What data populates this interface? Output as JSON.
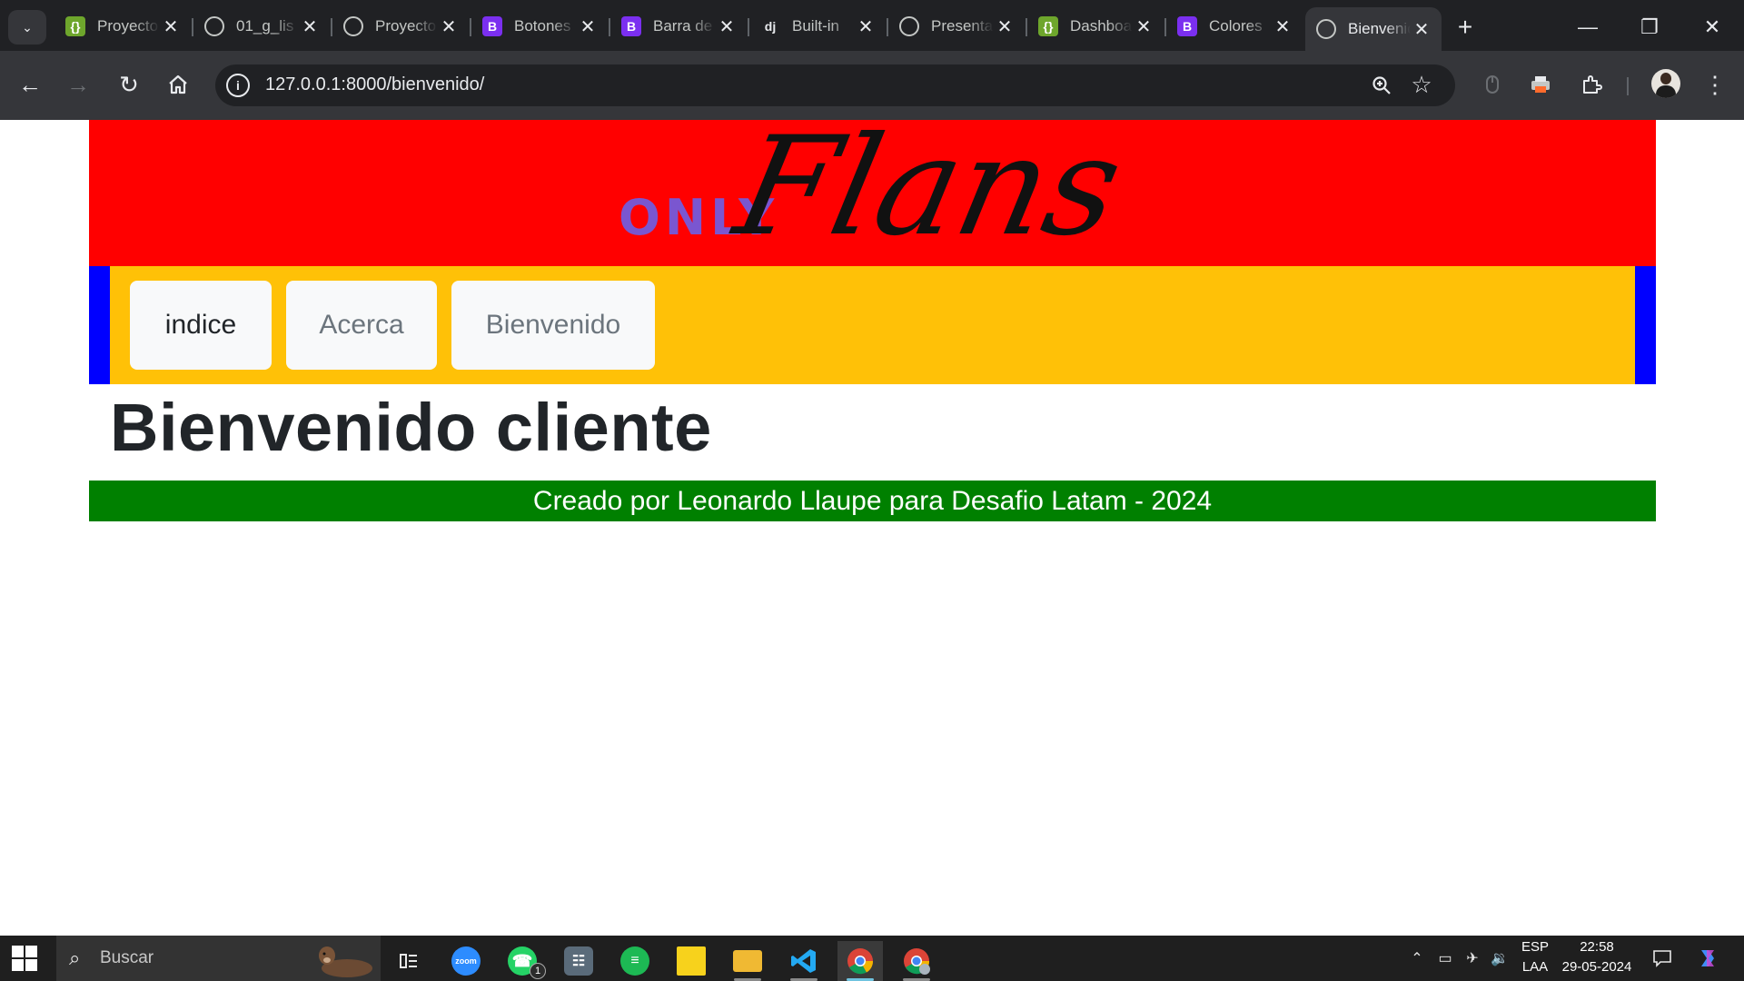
{
  "browser": {
    "tabs": [
      {
        "title": "Proyecto",
        "favicon": "json-icon"
      },
      {
        "title": "01_g_lis",
        "favicon": "globe-icon"
      },
      {
        "title": "Proyecto",
        "favicon": "globe-icon"
      },
      {
        "title": "Botones",
        "favicon": "bootstrap-icon"
      },
      {
        "title": "Barra de",
        "favicon": "bootstrap-icon"
      },
      {
        "title": "Built-in",
        "favicon": "django-icon"
      },
      {
        "title": "Presenta",
        "favicon": "globe-icon"
      },
      {
        "title": "Dashboar",
        "favicon": "json-icon"
      },
      {
        "title": "Colores",
        "favicon": "bootstrap-icon"
      },
      {
        "title": "Bienvenido",
        "favicon": "globe-icon",
        "active": true
      }
    ],
    "favicon_glyphs": {
      "json": "{}",
      "bootstrap": "B",
      "django": "dj"
    },
    "address_url": "127.0.0.1:8000/bienvenido/"
  },
  "page": {
    "logo_only": "ONLY",
    "logo_script": "Flans",
    "nav": [
      {
        "label": "indice",
        "active": true
      },
      {
        "label": "Acerca",
        "active": false
      },
      {
        "label": "Bienvenido",
        "active": false
      }
    ],
    "heading": "Bienvenido cliente",
    "footer": "Creado por Leonardo Llaupe para Desafio Latam - 2024",
    "colors": {
      "header": "#ff0000",
      "nav_outer": "#0000ff",
      "nav_inner": "#ffc107",
      "footer": "#008000",
      "logo_only": "#7a56d0"
    }
  },
  "taskbar": {
    "search_placeholder": "Buscar",
    "apps": [
      "zoom-icon",
      "whatsapp-icon",
      "calculator-icon",
      "spotify-icon",
      "sticky-notes-icon",
      "file-explorer-icon",
      "vscode-icon",
      "chrome-icon",
      "chrome-alt-icon"
    ],
    "whatsapp_badge": "1",
    "zoom_label": "zoom",
    "language_top": "ESP",
    "language_bottom": "LAA",
    "time": "22:58",
    "date": "29-05-2024"
  }
}
